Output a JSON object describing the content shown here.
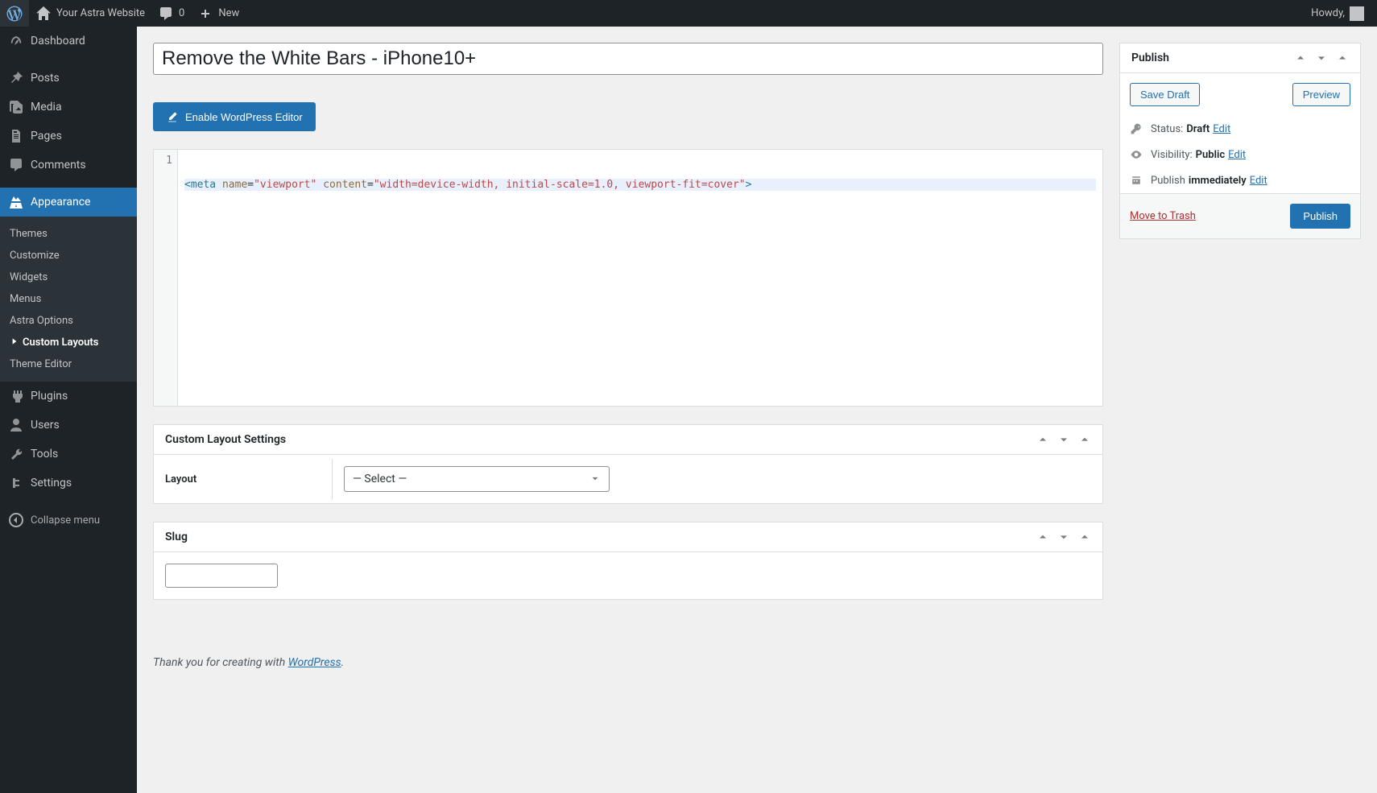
{
  "adminbar": {
    "site_name": "Your Astra Website",
    "comments_count": "0",
    "new_label": "New",
    "howdy": "Howdy,"
  },
  "sidebar": {
    "items": [
      {
        "label": "Dashboard"
      },
      {
        "label": "Posts"
      },
      {
        "label": "Media"
      },
      {
        "label": "Pages"
      },
      {
        "label": "Comments"
      },
      {
        "label": "Appearance"
      },
      {
        "label": "Plugins"
      },
      {
        "label": "Users"
      },
      {
        "label": "Tools"
      },
      {
        "label": "Settings"
      }
    ],
    "appearance_submenu": [
      {
        "label": "Themes"
      },
      {
        "label": "Customize"
      },
      {
        "label": "Widgets"
      },
      {
        "label": "Menus"
      },
      {
        "label": "Astra Options"
      },
      {
        "label": "Custom Layouts"
      },
      {
        "label": "Theme Editor"
      }
    ],
    "collapse_label": "Collapse menu"
  },
  "editor": {
    "title_value": "Remove the White Bars - iPhone10+",
    "enable_editor_label": "Enable WordPress Editor",
    "code": {
      "line_number": "1",
      "rendered_html": "<span class=\"tag-br\">&lt;meta</span> <span class=\"attr-name\">name</span><span class=\"plain\">=</span><span class=\"attr-val\">\"viewport\"</span> <span class=\"attr-name\">content</span><span class=\"plain\">=</span><span class=\"attr-val\">\"width=device-width, initial-scale=1.0, viewport-fit=cover\"</span><span class=\"tag-br\">&gt;</span>"
    }
  },
  "custom_layout_box": {
    "heading": "Custom Layout Settings",
    "layout_label": "Layout",
    "layout_selected": "— Select —"
  },
  "slug_box": {
    "heading": "Slug",
    "value": ""
  },
  "footer": {
    "prefix": "Thank you for creating with ",
    "link": "WordPress",
    "suffix": "."
  },
  "publish_box": {
    "heading": "Publish",
    "save_draft": "Save Draft",
    "preview": "Preview",
    "status_label": "Status:",
    "status_value": "Draft",
    "visibility_label": "Visibility:",
    "visibility_value": "Public",
    "publish_label": "Publish",
    "publish_value": "immediately",
    "edit": "Edit",
    "move_to_trash": "Move to Trash",
    "publish_btn": "Publish"
  }
}
